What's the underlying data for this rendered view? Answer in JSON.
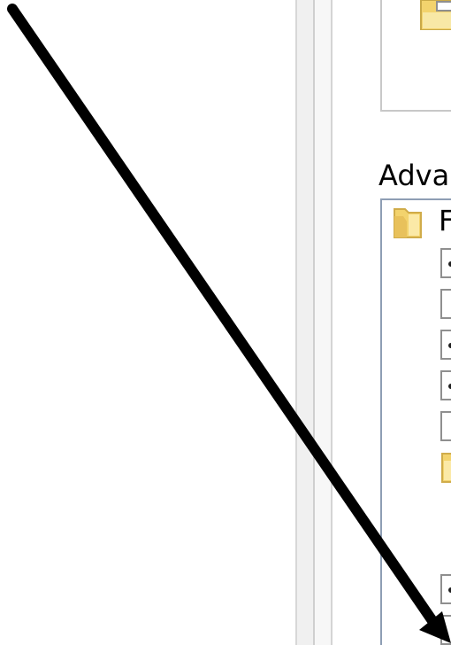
{
  "advanced_section": {
    "label": "Advar",
    "tree_root_label": "F",
    "options": [
      {
        "selected": true
      },
      {
        "selected": false
      },
      {
        "selected": true
      },
      {
        "selected": true
      },
      {
        "selected": false
      },
      {
        "selected": true
      },
      {
        "selected": false
      }
    ]
  },
  "icons": {
    "upper_folder": "folder-icon",
    "tree_root_folder": "folder-icon",
    "tree_sub_folder": "folder-icon",
    "overlay": "diagonal-arrow-annotation"
  },
  "colors": {
    "folder_yellow": "#f3d36d",
    "arrow": "#000000",
    "tree_border": "#8e9eb4"
  }
}
